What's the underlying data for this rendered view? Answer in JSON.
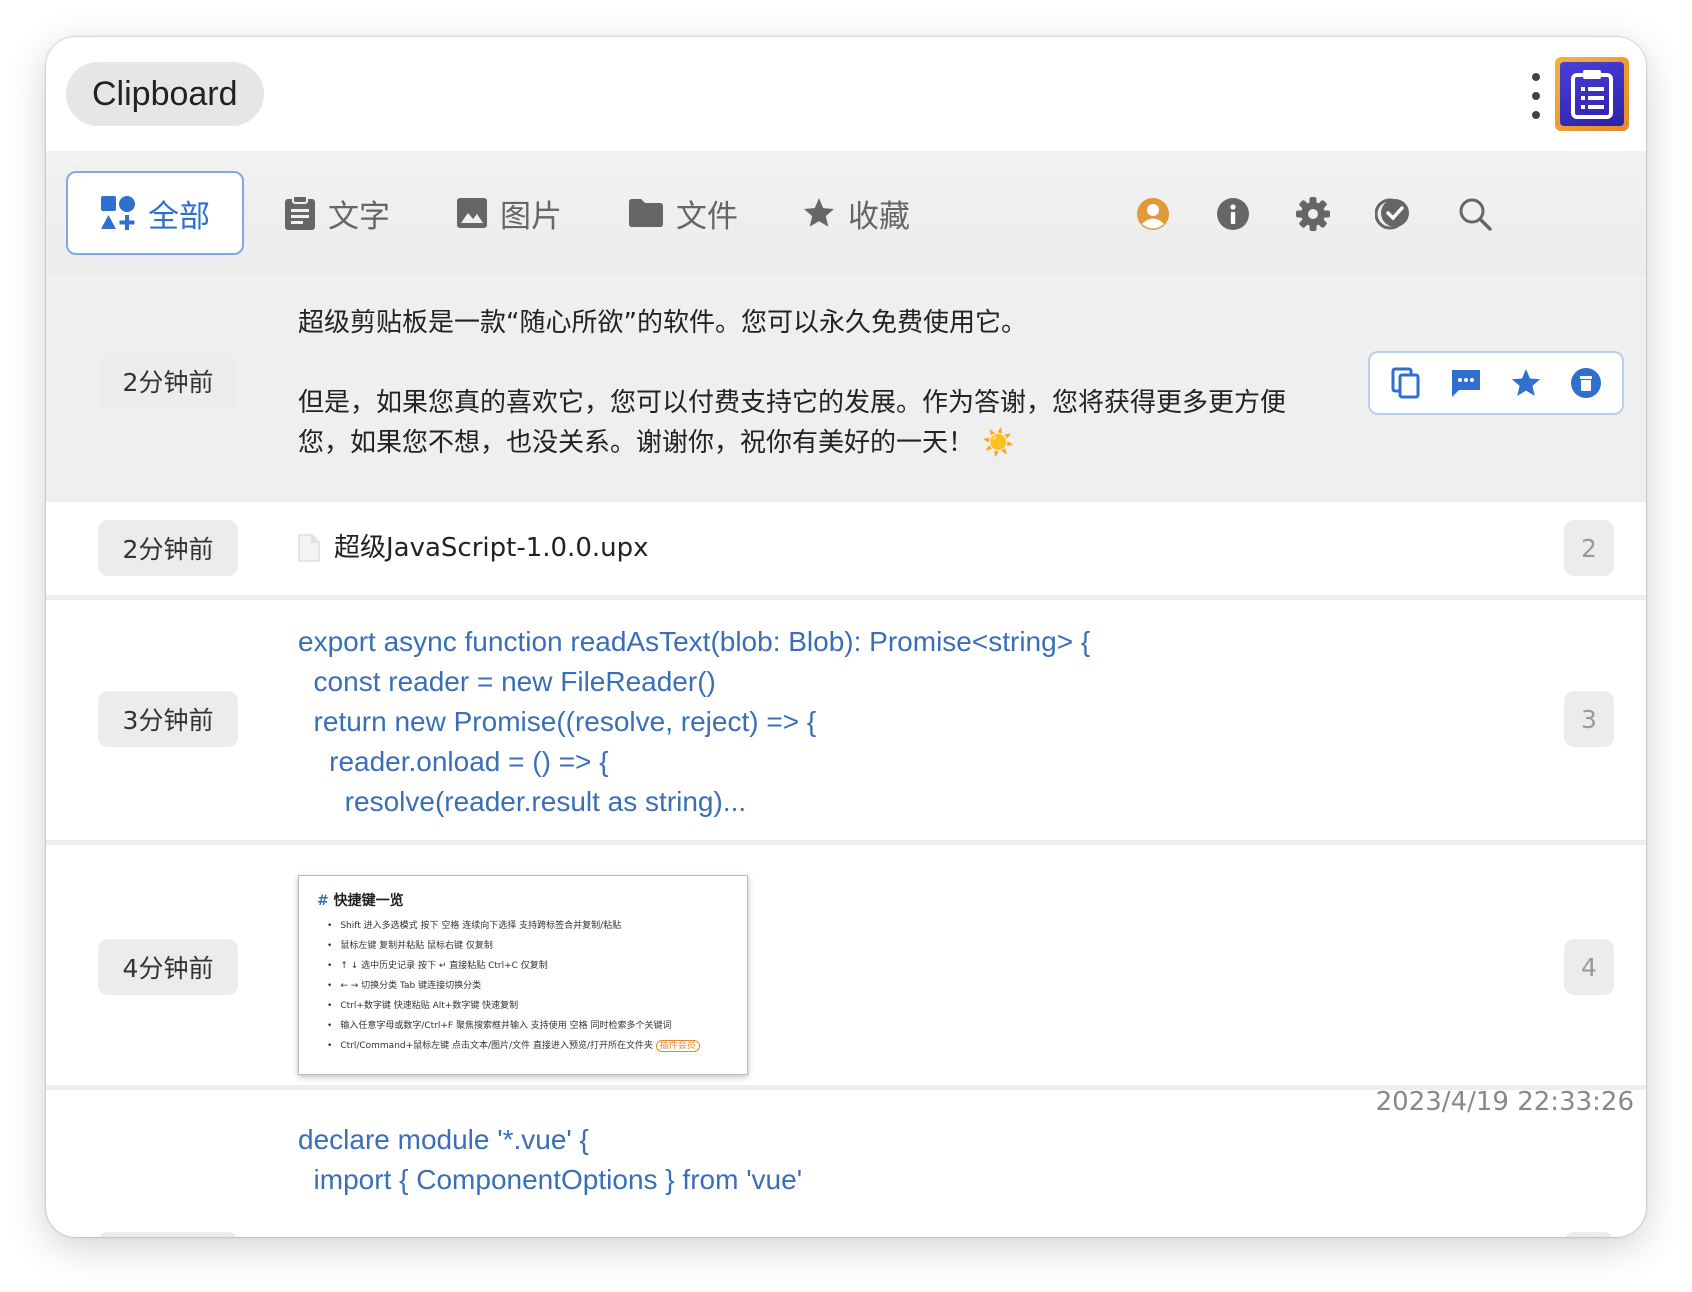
{
  "app": {
    "title": "Clipboard"
  },
  "tabs": [
    {
      "label": "全部",
      "icon": "category-icon",
      "active": true
    },
    {
      "label": "文字",
      "icon": "clipboard-text-icon",
      "active": false
    },
    {
      "label": "图片",
      "icon": "image-icon",
      "active": false
    },
    {
      "label": "文件",
      "icon": "folder-icon",
      "active": false
    },
    {
      "label": "收藏",
      "icon": "star-icon",
      "active": false
    }
  ],
  "toolbar_icons": [
    "user-icon",
    "info-icon",
    "gear-icon",
    "check-badge-icon",
    "search-icon"
  ],
  "colors": {
    "accent": "#2f6fce",
    "code": "#3a6fb8",
    "user": "#e09a3a",
    "badge_bg": "#ececec"
  },
  "items": [
    {
      "time": "2分钟前",
      "type": "text",
      "lines": [
        "超级剪贴板是一款“随心所欲”的软件。您可以永久免费使用它。",
        "",
        "但是，如果您真的喜欢它，您可以付费支持它的发展。作为答谢，您将获得更多更方便",
        "您，如果您不想，也没关系。谢谢你，祝你有美好的一天！"
      ],
      "emoji": "☀️",
      "actions": [
        "copy-icon",
        "comment-icon",
        "star-icon",
        "delete-icon"
      ]
    },
    {
      "time": "2分钟前",
      "type": "file",
      "filename": "超级JavaScript-1.0.0.upx",
      "index": "2"
    },
    {
      "time": "3分钟前",
      "type": "code",
      "code": "export async function readAsText(blob: Blob): Promise<string> {\n  const reader = new FileReader()\n  return new Promise((resolve, reject) => {\n    reader.onload = () => {\n      resolve(reader.result as string)...",
      "index": "3"
    },
    {
      "time": "4分钟前",
      "type": "image",
      "index": "4",
      "image": {
        "title_hash": "#",
        "title": "快捷键一览",
        "lines": [
          "Shift 进入多选模式 按下 空格 连续向下选择 支持跨标签合并复制/粘贴",
          "鼠标左键 复制并粘贴 鼠标右键 仅复制",
          "↑ ↓ 选中历史记录 按下 ↵ 直接粘贴 Ctrl+C 仅复制",
          "← → 切换分类 Tab 键连接切换分类",
          "Ctrl+数字键 快速粘贴 Alt+数字键 快速复制",
          "输入任意字母或数字/Ctrl+F 聚焦搜索框并输入 支持使用 空格 同时检索多个关键词",
          "Ctrl/Command+鼠标左键 点击文本/图片/文件 直接进入预览/打开所在文件夹"
        ],
        "tag": "插件会员"
      }
    },
    {
      "time": "",
      "type": "code",
      "code": "declare module '*.vue' {\n  import { ComponentOptions } from 'vue'"
    }
  ],
  "timestamp": "2023/4/19 22:33:26"
}
